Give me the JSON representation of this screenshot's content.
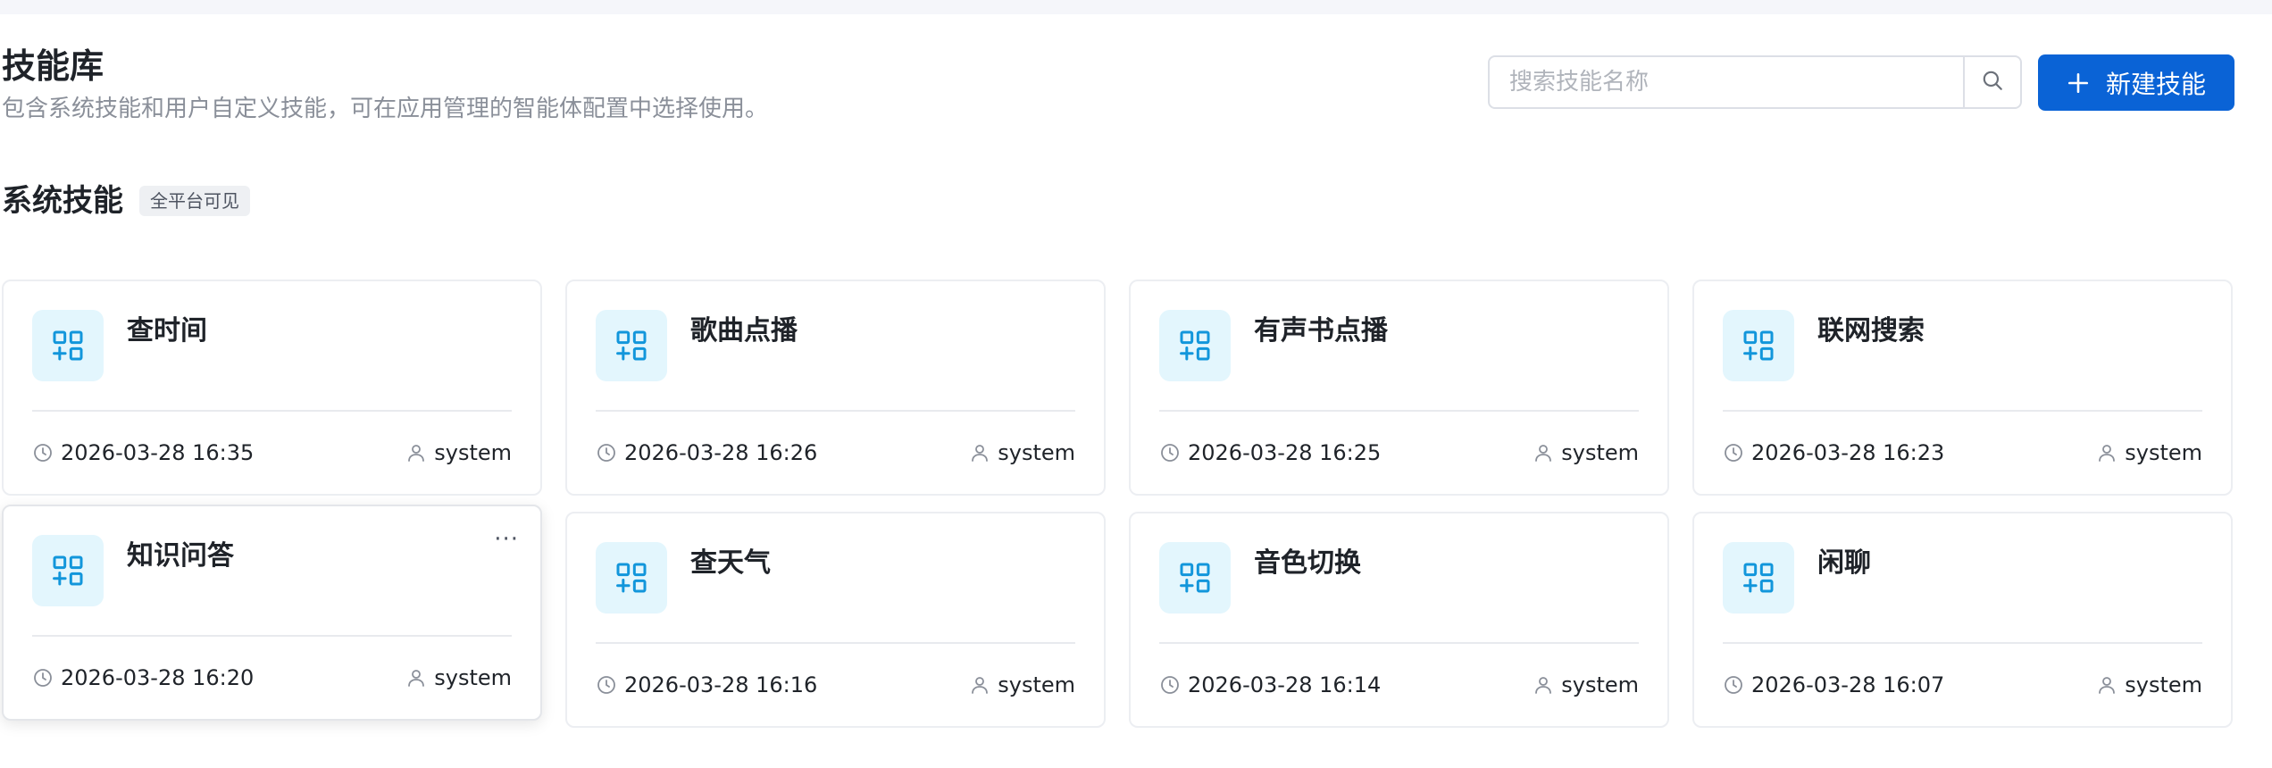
{
  "header": {
    "title": "技能库",
    "subtitle": "包含系统技能和用户自定义技能，可在应用管理的智能体配置中选择使用。"
  },
  "search": {
    "placeholder": "搜索技能名称",
    "value": "",
    "icon": "search-icon"
  },
  "new_button": {
    "label": "新建技能",
    "icon": "plus-icon",
    "color": "#0a63d6"
  },
  "section": {
    "title": "系统技能",
    "badge": "全平台可见"
  },
  "skills": [
    {
      "name": "查时间",
      "time": "2026-03-28 16:35",
      "author": "system",
      "icon": "skill-grid-icon"
    },
    {
      "name": "歌曲点播",
      "time": "2026-03-28 16:26",
      "author": "system",
      "icon": "skill-grid-icon"
    },
    {
      "name": "有声书点播",
      "time": "2026-03-28 16:25",
      "author": "system",
      "icon": "skill-grid-icon"
    },
    {
      "name": "联网搜索",
      "time": "2026-03-28 16:23",
      "author": "system",
      "icon": "skill-grid-icon"
    },
    {
      "name": "知识问答",
      "time": "2026-03-28 16:20",
      "author": "system",
      "icon": "skill-grid-icon",
      "more": "···"
    },
    {
      "name": "查天气",
      "time": "2026-03-28 16:16",
      "author": "system",
      "icon": "skill-grid-icon"
    },
    {
      "name": "音色切换",
      "time": "2026-03-28 16:14",
      "author": "system",
      "icon": "skill-grid-icon"
    },
    {
      "name": "闲聊",
      "time": "2026-03-28 16:07",
      "author": "system",
      "icon": "skill-grid-icon"
    }
  ],
  "colors": {
    "accent": "#0a63d6",
    "icon_bg": "#e3f6fd",
    "icon_fg": "#1296db"
  }
}
